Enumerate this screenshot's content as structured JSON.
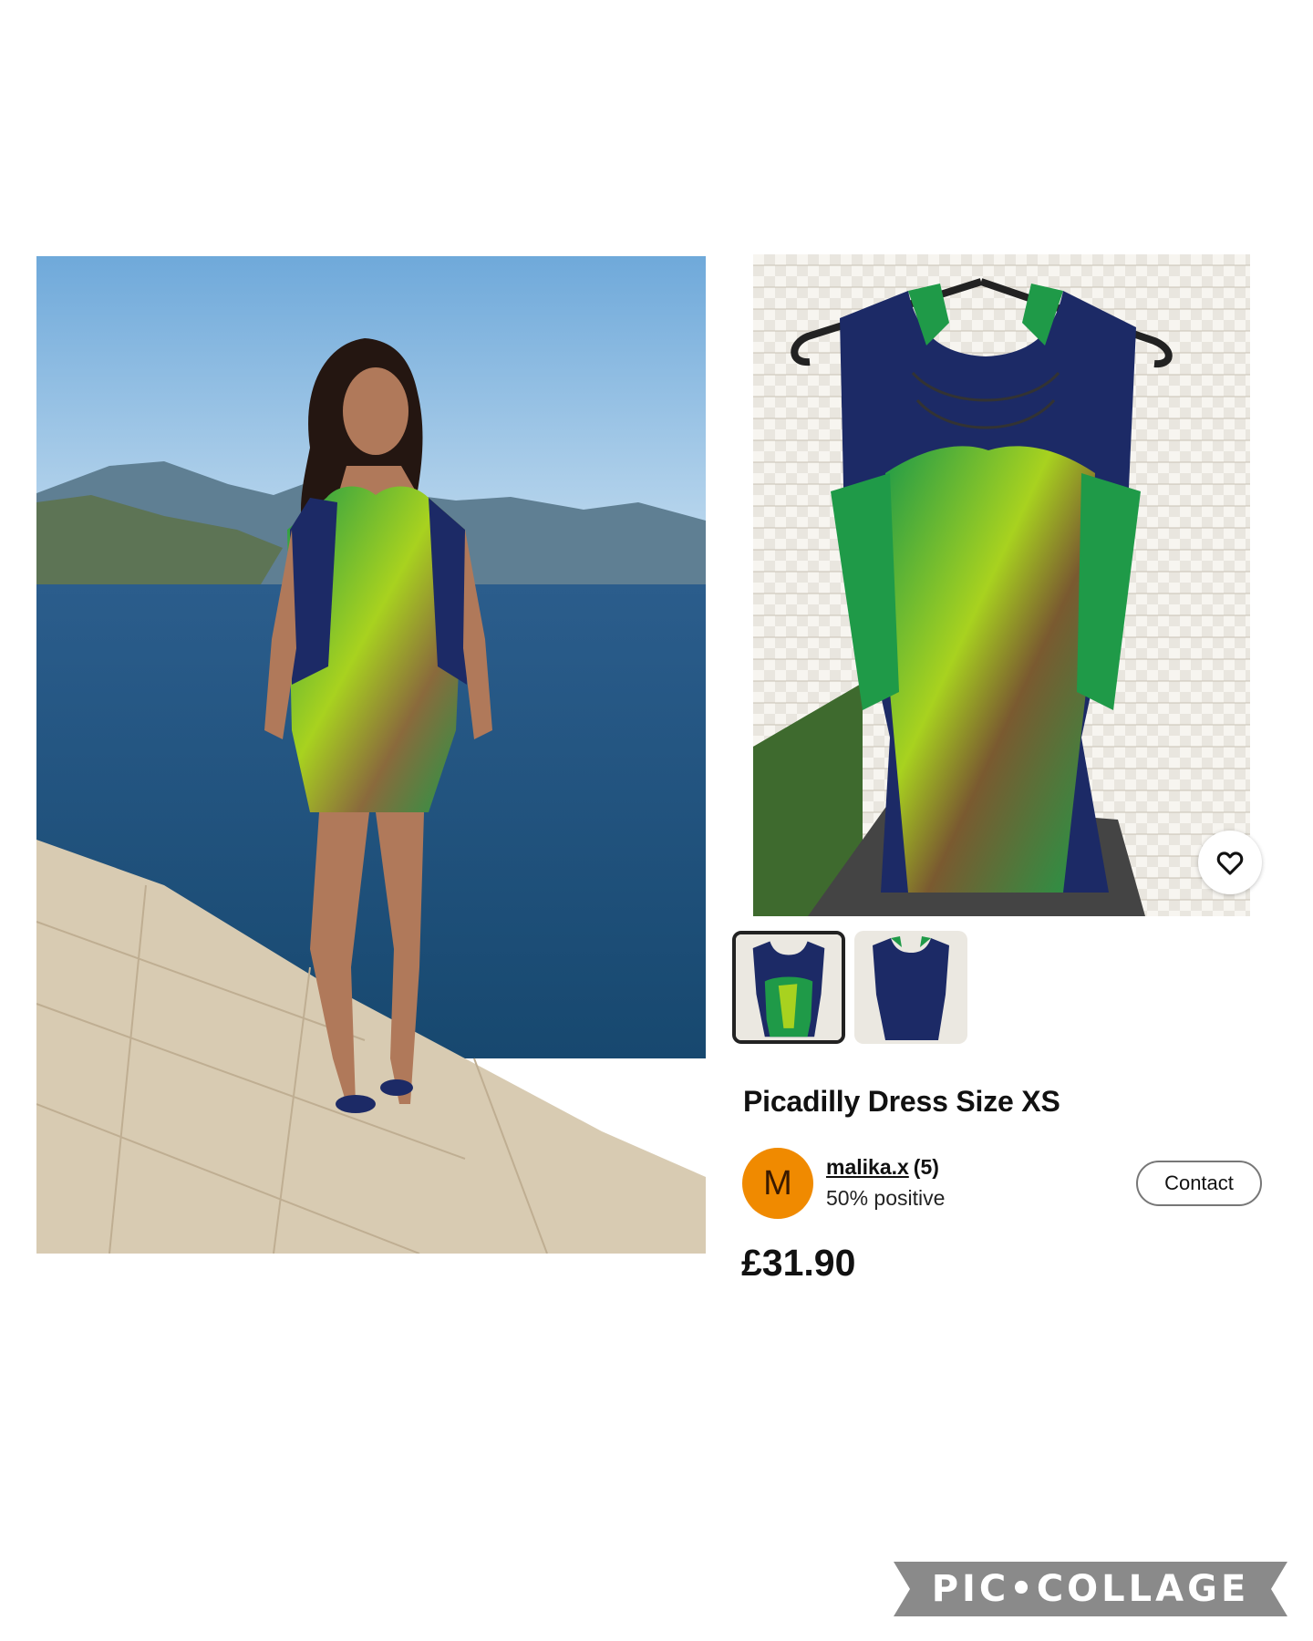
{
  "listing": {
    "title": "Picadilly Dress Size XS",
    "price": "£31.90"
  },
  "seller": {
    "avatar_letter": "M",
    "name": "malika.x",
    "rating_count": "(5)",
    "feedback": "50% positive",
    "contact_label": "Contact"
  },
  "icons": {
    "favorite": "heart-icon"
  },
  "images": {
    "thumbnails": [
      "dress-front-thumbnail",
      "dress-back-thumbnail"
    ],
    "selected_thumbnail": 1
  },
  "watermark": {
    "text": "PIC•COLLAGE"
  },
  "colors": {
    "avatar": "#f08a00",
    "dress_navy": "#1c2a66",
    "dress_green": "#1f9a48",
    "dress_lime": "#a8d21f",
    "sea": "#2c5f8f",
    "sky": "#9cc6e6"
  }
}
